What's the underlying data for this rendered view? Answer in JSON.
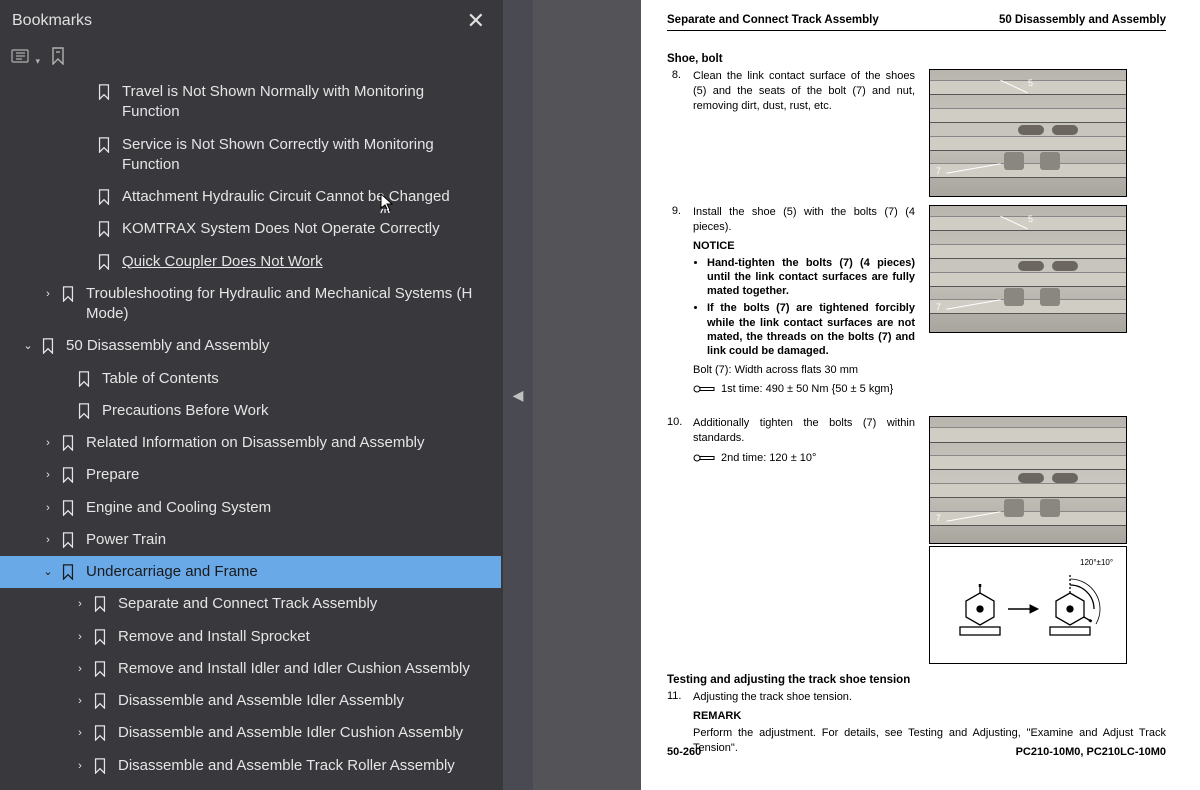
{
  "sidebar": {
    "title": "Bookmarks",
    "items": [
      {
        "indent": 5,
        "chevron": "",
        "label": "Travel is Not Shown Normally with Monitoring Function",
        "selected": false
      },
      {
        "indent": 5,
        "chevron": "",
        "label": "Service is Not Shown Correctly with Monitoring Function",
        "selected": false
      },
      {
        "indent": 5,
        "chevron": "",
        "label": "Attachment Hydraulic Circuit Cannot be Changed",
        "selected": false
      },
      {
        "indent": 5,
        "chevron": "",
        "label": "KOMTRAX System Does Not Operate Correctly",
        "selected": false
      },
      {
        "indent": 5,
        "chevron": "",
        "label": "Quick Coupler Does Not Work",
        "selected": false,
        "underlined": true
      },
      {
        "indent": 2,
        "chevron": "right",
        "label": "Troubleshooting for Hydraulic and Mechanical Systems (H Mode)",
        "selected": false
      },
      {
        "indent": 1,
        "chevron": "down",
        "label": "50 Disassembly and Assembly",
        "selected": false
      },
      {
        "indent": 3,
        "chevron": "",
        "label": "Table of Contents",
        "selected": false
      },
      {
        "indent": 3,
        "chevron": "",
        "label": "Precautions Before Work",
        "selected": false
      },
      {
        "indent": 2,
        "chevron": "right",
        "label": "Related Information on Disassembly and Assembly",
        "selected": false
      },
      {
        "indent": 2,
        "chevron": "right",
        "label": "Prepare",
        "selected": false
      },
      {
        "indent": 2,
        "chevron": "right",
        "label": "Engine and Cooling System",
        "selected": false
      },
      {
        "indent": 2,
        "chevron": "right",
        "label": "Power Train",
        "selected": false
      },
      {
        "indent": 2,
        "chevron": "down",
        "label": "Undercarriage and Frame",
        "selected": true
      },
      {
        "indent": 4,
        "chevron": "right",
        "label": "Separate and Connect Track Assembly",
        "selected": false
      },
      {
        "indent": 4,
        "chevron": "right",
        "label": "Remove and Install Sprocket",
        "selected": false
      },
      {
        "indent": 4,
        "chevron": "right",
        "label": "Remove and Install Idler and Idler Cushion Assembly",
        "selected": false
      },
      {
        "indent": 4,
        "chevron": "right",
        "label": "Disassemble and Assemble Idler Assembly",
        "selected": false
      },
      {
        "indent": 4,
        "chevron": "right",
        "label": "Disassemble and Assemble Idler Cushion Assembly",
        "selected": false
      },
      {
        "indent": 4,
        "chevron": "right",
        "label": "Disassemble and Assemble Track Roller Assembly",
        "selected": false
      }
    ]
  },
  "doc": {
    "header_left": "Separate and Connect Track Assembly",
    "header_right": "50 Disassembly and Assembly",
    "section_title": "Shoe, bolt",
    "step8_num": "8.",
    "step8_text": "Clean the link contact surface of the shoes (5) and the seats of the bolt (7) and nut, removing dirt, dust, rust, etc.",
    "step9_num": "9.",
    "step9_text": "Install the shoe (5) with the bolts (7) (4 pieces).",
    "notice_label": "NOTICE",
    "notice_item1": "Hand-tighten the bolts (7) (4 pieces) until the link contact surfaces are fully mated together.",
    "notice_item2": "If the bolts (7) are tightened forcibly while the link contact surfaces are not mated, the threads on the bolts (7) and link could be damaged.",
    "bolt_spec": "Bolt (7): Width across flats 30 mm",
    "torque1": "1st time: 490 ± 50 Nm {50 ± 5 kgm}",
    "step10_num": "10.",
    "step10_text": "Additionally tighten the bolts (7) within standards.",
    "torque2": "2nd time: 120 ± 10°",
    "diagram_label": "120°±10°",
    "testing_title": "Testing and adjusting the track shoe tension",
    "step11_num": "11.",
    "step11_text": "Adjusting the track shoe tension.",
    "remark_label": "REMARK",
    "remark_text": "Perform the adjustment. For details, see Testing and Adjusting, \"Examine and Adjust Track Tension\".",
    "footer_left": "50-260",
    "footer_right": "PC210-10M0, PC210LC-10M0"
  }
}
